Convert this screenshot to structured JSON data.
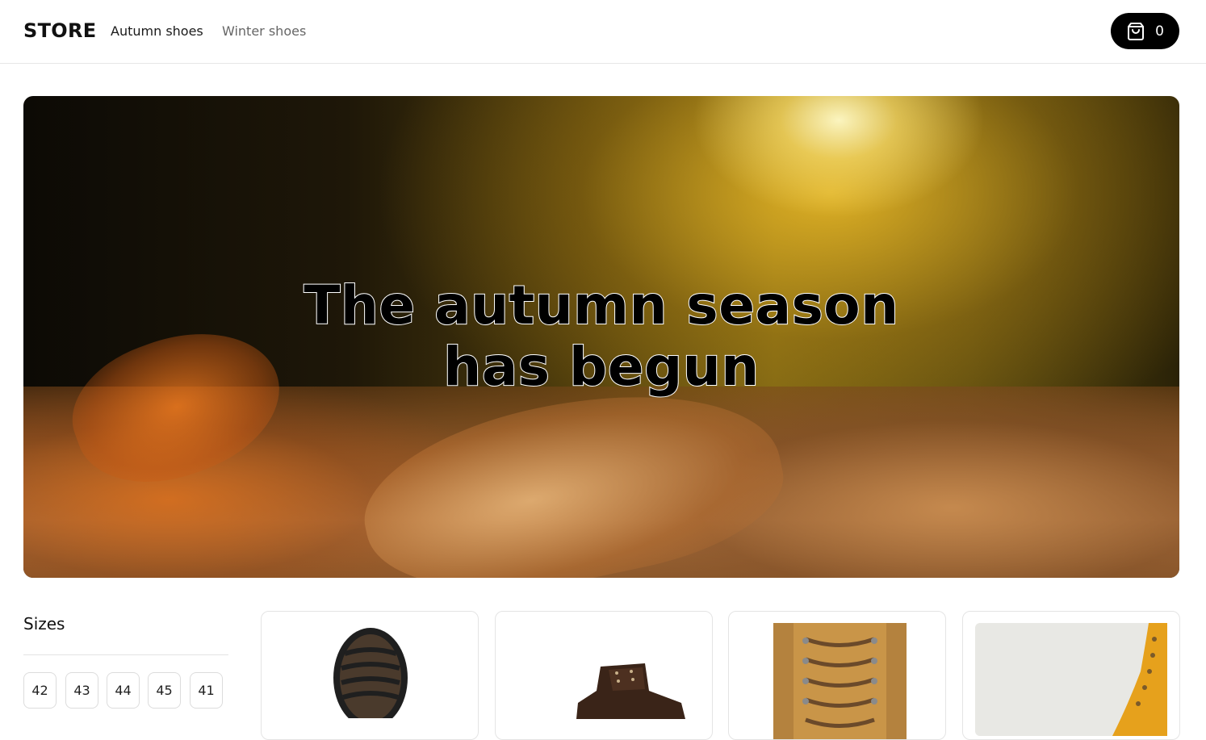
{
  "header": {
    "logo": "STORE",
    "nav": [
      {
        "label": "Autumn shoes",
        "active": true
      },
      {
        "label": "Winter shoes",
        "active": false
      }
    ],
    "cart": {
      "icon": "shopping-bag-icon",
      "count": "0"
    }
  },
  "hero": {
    "title_line1": "The autumn season",
    "title_line2": "has begun"
  },
  "sizes": {
    "title": "Sizes",
    "options": [
      "42",
      "43",
      "44",
      "45",
      "41"
    ]
  },
  "products": [
    {
      "image": "shoe-sole-image"
    },
    {
      "image": "brown-leather-boot-image"
    },
    {
      "image": "tan-work-boot-laces-image"
    },
    {
      "image": "yellow-boot-image"
    }
  ],
  "colors": {
    "accent": "#000000",
    "border": "#e4e4e4",
    "nav_inactive": "#666666"
  }
}
